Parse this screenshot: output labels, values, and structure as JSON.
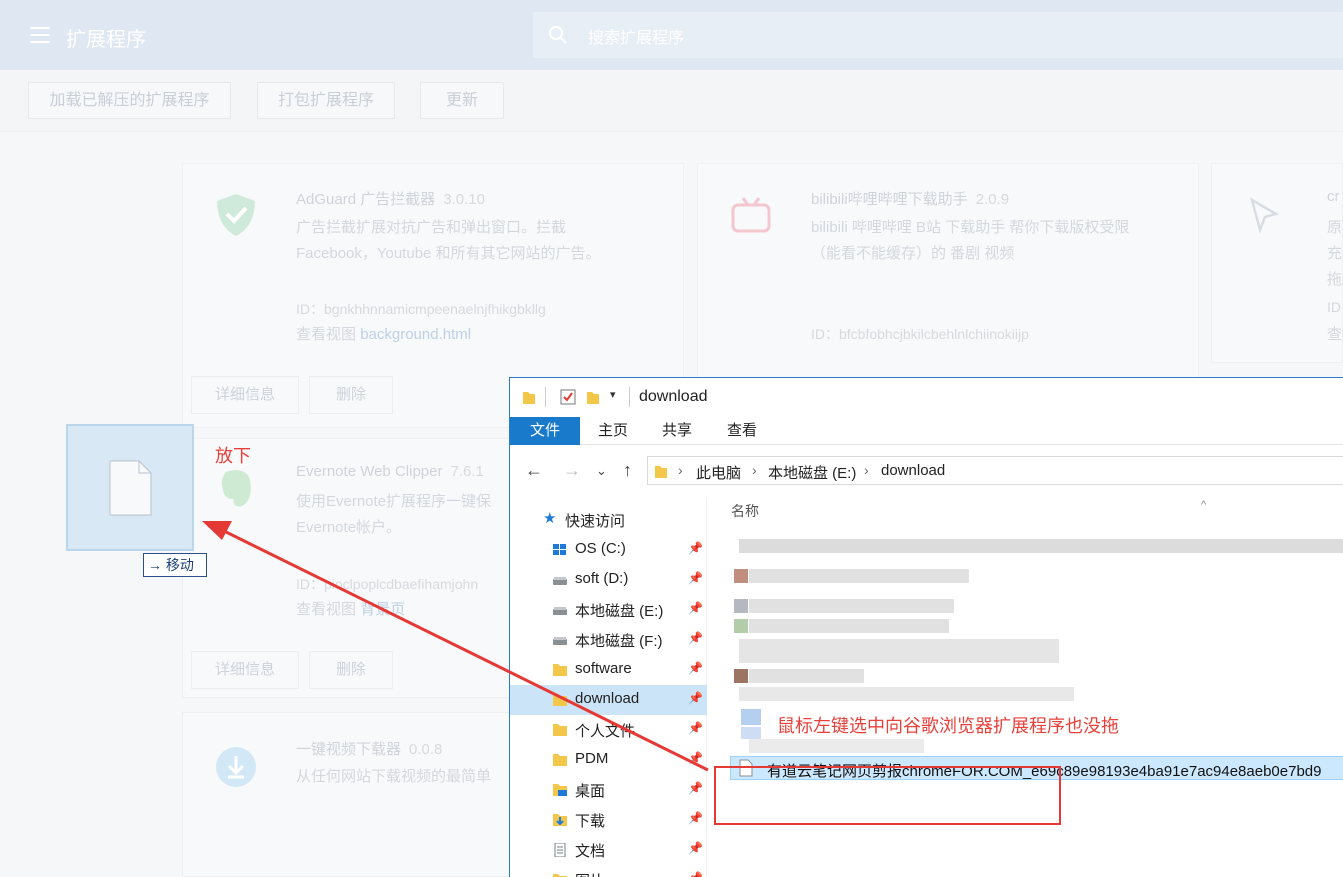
{
  "header": {
    "title": "扩展程序",
    "search_placeholder": "搜索扩展程序"
  },
  "devbar": {
    "load_unpacked": "加载已解压的扩展程序",
    "pack": "打包扩展程序",
    "update": "更新"
  },
  "cards": [
    {
      "name": "AdGuard 广告拦截器",
      "version": "3.0.10",
      "desc1": "广告拦截扩展对抗广告和弹出窗口。拦截",
      "desc2": "Facebook，Youtube 和所有其它网站的广告。",
      "id": "ID：bgnkhhnnamicmpeenaelnjfhikgbkllg",
      "view_prefix": "查看视图",
      "view_link": "background.html",
      "details": "详细信息",
      "remove": "删除"
    },
    {
      "name": "bilibili哔哩哔哩下载助手",
      "version": "2.0.9",
      "desc1": "bilibili 哔哩哔哩 B站 下载助手 帮你下载版权受限",
      "desc2": "（能看不能缓存）的 番剧 视频",
      "id": "ID：bfcbfobhcjbkilcbehlnlchiinokiijp"
    },
    {
      "name": "Evernote Web Clipper",
      "version": "7.6.1",
      "desc1": "使用Evernote扩展程序一键保",
      "desc2": "Evernote帐户。",
      "id": "ID：pioclpoplcdbaefihamjohn",
      "view_prefix": "查看视图",
      "view_link": "背景页",
      "details": "详细信息",
      "remove": "删除"
    },
    {
      "name": "一键视频下载器",
      "version": "0.0.8",
      "desc1": "从任何网站下载视频的最简单"
    },
    {
      "name": "cr",
      "desc_a": "原",
      "desc_b": "充",
      "desc_c": "拖",
      "id": "ID",
      "view": "查"
    }
  ],
  "drag": {
    "drop_label": "放下",
    "move_label": "移动"
  },
  "explorer": {
    "title": "download",
    "tabs": [
      "文件",
      "主页",
      "共享",
      "查看"
    ],
    "breadcrumb": [
      "此电脑",
      "本地磁盘 (E:)",
      "download"
    ],
    "nav": [
      {
        "label": "快速访问",
        "icon": "star-icon"
      },
      {
        "label": "OS (C:)",
        "icon": "windows-drive-icon",
        "pinned": true
      },
      {
        "label": "soft (D:)",
        "icon": "drive-icon",
        "pinned": true
      },
      {
        "label": "本地磁盘 (E:)",
        "icon": "drive-icon",
        "pinned": true
      },
      {
        "label": "本地磁盘 (F:)",
        "icon": "drive-icon",
        "pinned": true
      },
      {
        "label": "software",
        "icon": "folder-icon",
        "pinned": true
      },
      {
        "label": "download",
        "icon": "folder-icon",
        "pinned": true,
        "selected": true
      },
      {
        "label": "个人文件",
        "icon": "folder-icon",
        "pinned": true
      },
      {
        "label": "PDM",
        "icon": "folder-icon",
        "pinned": true
      },
      {
        "label": "桌面",
        "icon": "desktop-folder-icon",
        "pinned": true
      },
      {
        "label": "下载",
        "icon": "download-folder-icon",
        "pinned": true
      },
      {
        "label": "文档",
        "icon": "documents-icon",
        "pinned": true
      },
      {
        "label": "图片",
        "icon": "pictures-icon",
        "pinned": true
      }
    ],
    "column_name": "名称",
    "selected_file": "有道云笔记网页剪报chromeFOR.COM_e69c89e98193e4ba91e7ac94e8aeb0e7bd9"
  },
  "annotation": {
    "note": "鼠标左键选中向谷歌浏览器扩展程序也没拖",
    "color": "#e8413b"
  }
}
